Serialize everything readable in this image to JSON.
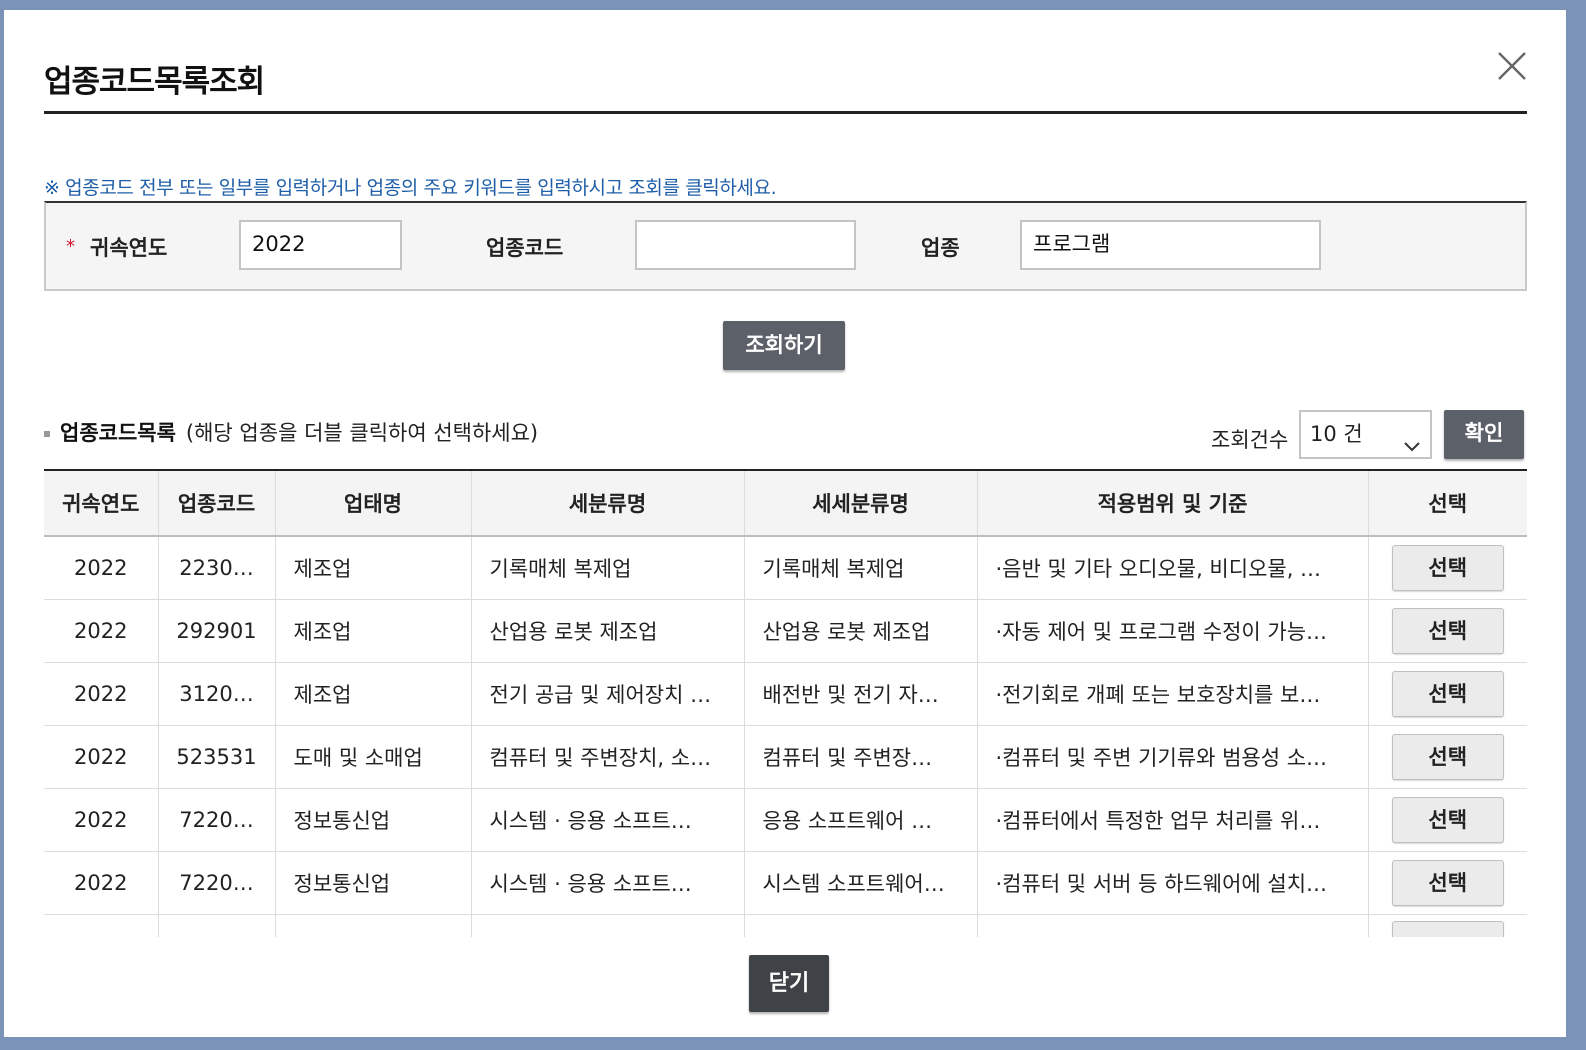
{
  "dialog": {
    "title": "업종코드목록조회",
    "close_icon": "close-icon"
  },
  "notice": "※ 업종코드 전부 또는 일부를 입력하거나 업종의 주요 키워드를 입력하시고 조회를 클릭하세요.",
  "search": {
    "required_mark": "*",
    "year_label": "귀속연도",
    "year_value": "2022",
    "code_label": "업종코드",
    "code_value": "",
    "industry_label": "업종",
    "industry_value": "프로그램",
    "search_button": "조회하기"
  },
  "list": {
    "title": "업종코드목록",
    "hint": "(해당 업종을 더블 클릭하여 선택하세요)",
    "count_label": "조회건수",
    "count_value": "10 건",
    "confirm_button": "확인",
    "columns": [
      "귀속연도",
      "업종코드",
      "업태명",
      "세분류명",
      "세세분류명",
      "적용범위 및 기준",
      "선택"
    ],
    "rows": [
      {
        "year": "2022",
        "code": "2230…",
        "business": "제조업",
        "subclass": "기록매체 복제업",
        "detail": "기록매체 복제업",
        "scope": "·음반 및 기타 오디오물, 비디오물, …",
        "select": "선택"
      },
      {
        "year": "2022",
        "code": "292901",
        "business": "제조업",
        "subclass": "산업용 로봇 제조업",
        "detail": "산업용 로봇 제조업",
        "scope": "·자동 제어 및 프로그램 수정이 가능…",
        "select": "선택"
      },
      {
        "year": "2022",
        "code": "3120…",
        "business": "제조업",
        "subclass": "전기 공급 및 제어장치 …",
        "detail": "배전반 및 전기 자…",
        "scope": "·전기회로 개폐 또는 보호장치를 보…",
        "select": "선택"
      },
      {
        "year": "2022",
        "code": "523531",
        "business": "도매 및 소매업",
        "subclass": "컴퓨터 및 주변장치, 소…",
        "detail": "컴퓨터 및 주변장…",
        "scope": "·컴퓨터 및 주변 기기류와 범용성 소…",
        "select": "선택"
      },
      {
        "year": "2022",
        "code": "7220…",
        "business": "정보통신업",
        "subclass": "시스템 · 응용 소프트…",
        "detail": "응용 소프트웨어 …",
        "scope": "·컴퓨터에서 특정한 업무 처리를 위…",
        "select": "선택"
      },
      {
        "year": "2022",
        "code": "7220…",
        "business": "정보통신업",
        "subclass": "시스템 · 응용 소프트…",
        "detail": "시스템 소프트웨어…",
        "scope": "·컴퓨터 및 서버 등 하드웨어에 설치…",
        "select": "선택"
      },
      {
        "year": "",
        "code": "",
        "business": "",
        "subclass": "",
        "detail": "",
        "scope": "",
        "select": ""
      }
    ]
  },
  "footer": {
    "close_button": "닫기"
  }
}
